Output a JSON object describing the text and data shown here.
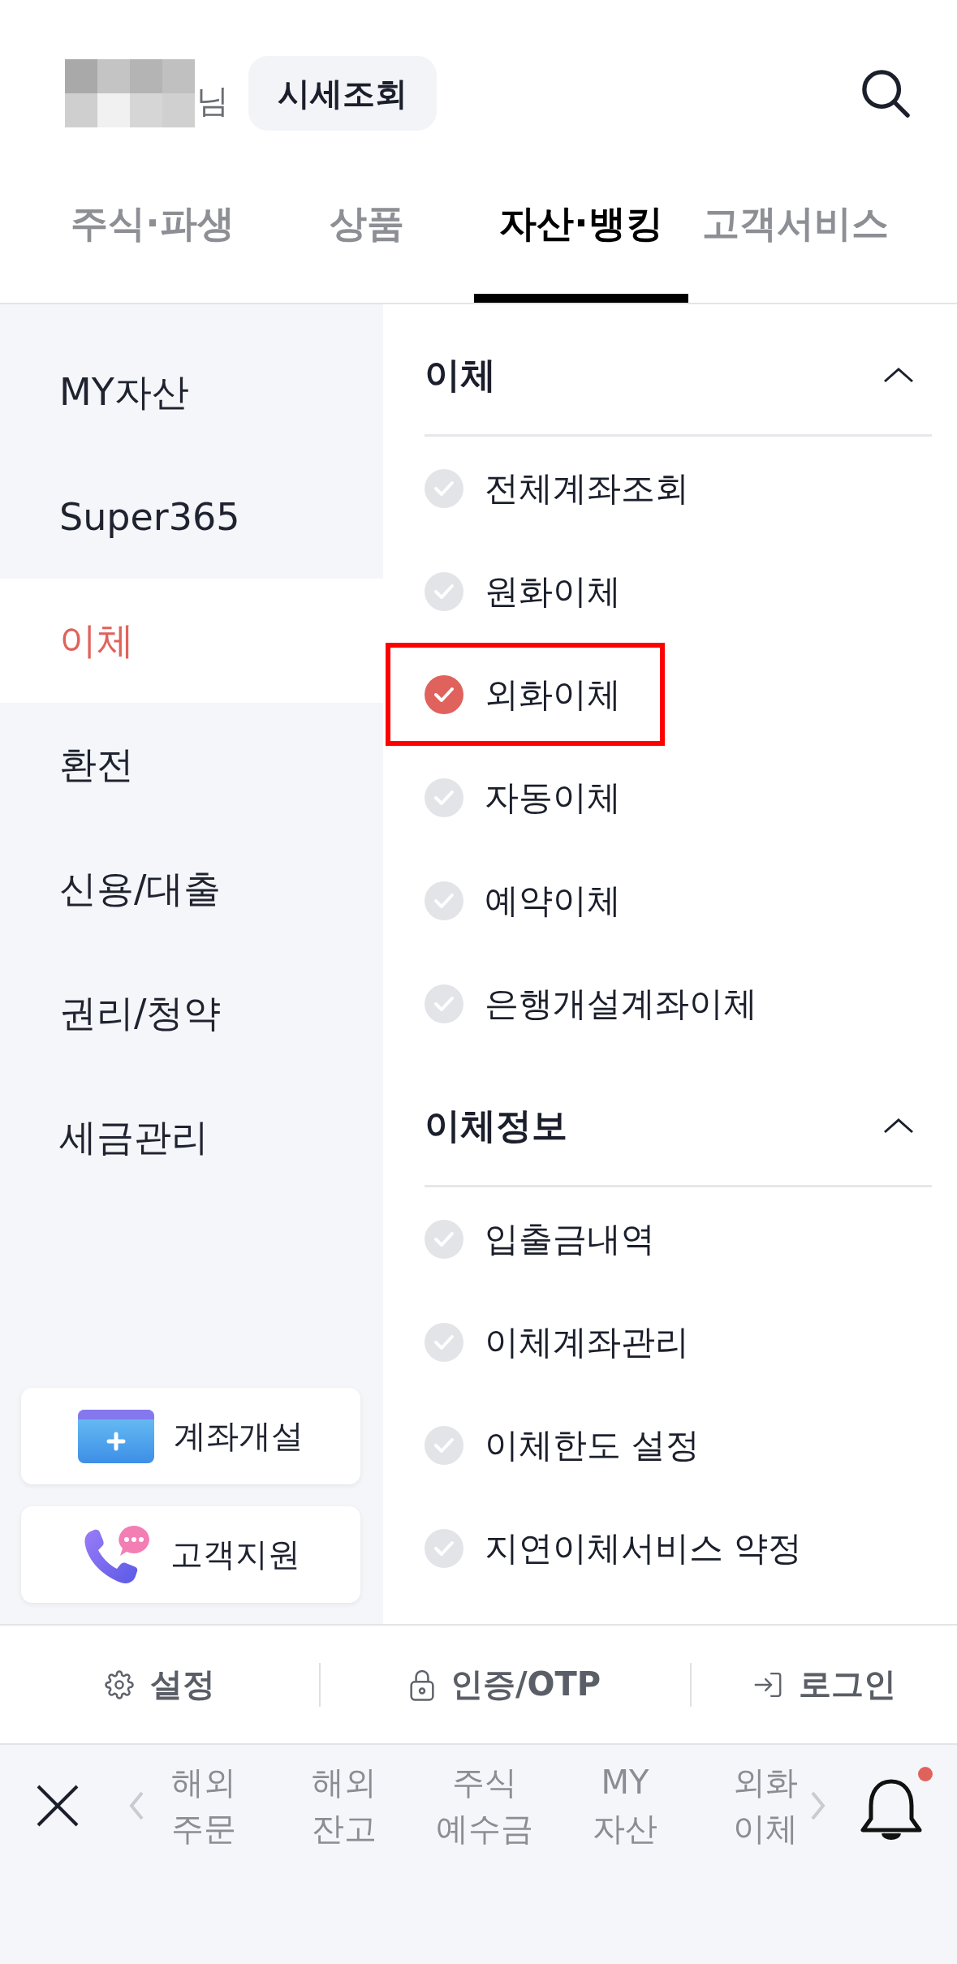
{
  "header": {
    "name_suffix": "님",
    "quote_button": "시세조회"
  },
  "tabs": [
    {
      "label": "주식·파생",
      "selected": false
    },
    {
      "label": "상품",
      "selected": false
    },
    {
      "label": "자산·뱅킹",
      "selected": true
    },
    {
      "label": "고객서비스",
      "selected": false
    }
  ],
  "sidebar": {
    "items": [
      {
        "label": "MY자산",
        "selected": false
      },
      {
        "label": "Super365",
        "selected": false
      },
      {
        "label": "이체",
        "selected": true
      },
      {
        "label": "환전",
        "selected": false
      },
      {
        "label": "신용/대출",
        "selected": false
      },
      {
        "label": "권리/청약",
        "selected": false
      },
      {
        "label": "세금관리",
        "selected": false
      }
    ],
    "cards": [
      {
        "kind": "account",
        "label": "계좌개설"
      },
      {
        "kind": "support",
        "label": "고객지원"
      }
    ]
  },
  "menu_sections": [
    {
      "title": "이체",
      "expanded": true,
      "items": [
        {
          "label": "전체계좌조회",
          "selected": false,
          "highlighted": false
        },
        {
          "label": "원화이체",
          "selected": false,
          "highlighted": false
        },
        {
          "label": "외화이체",
          "selected": true,
          "highlighted": true
        },
        {
          "label": "자동이체",
          "selected": false,
          "highlighted": false
        },
        {
          "label": "예약이체",
          "selected": false,
          "highlighted": false
        },
        {
          "label": "은행개설계좌이체",
          "selected": false,
          "highlighted": false
        }
      ]
    },
    {
      "title": "이체정보",
      "expanded": true,
      "items": [
        {
          "label": "입출금내역",
          "selected": false,
          "highlighted": false
        },
        {
          "label": "이체계좌관리",
          "selected": false,
          "highlighted": false
        },
        {
          "label": "이체한도 설정",
          "selected": false,
          "highlighted": false
        },
        {
          "label": "지연이체서비스 약정",
          "selected": false,
          "highlighted": false
        }
      ]
    }
  ],
  "footer_links": [
    {
      "kind": "settings",
      "label": "설정"
    },
    {
      "kind": "lock",
      "label": "인증/OTP"
    },
    {
      "kind": "login",
      "label": "로그인"
    }
  ],
  "shortcut_bar": {
    "items": [
      "해외 주문",
      "해외 잔고",
      "주식 예수금",
      "MY 자산",
      "외화 이체"
    ],
    "has_notification": true
  }
}
